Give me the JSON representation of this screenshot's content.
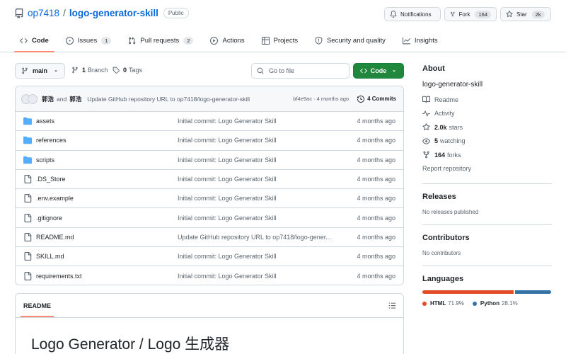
{
  "repo": {
    "owner": "op7418",
    "separator": "/",
    "name": "logo-generator-skill",
    "visibility": "Public"
  },
  "header_buttons": {
    "notifications": "Notifications",
    "fork": "Fork",
    "fork_count": "164",
    "star": "Star",
    "star_count": "2k"
  },
  "tabs": [
    {
      "label": "Code",
      "icon": "code-icon",
      "active": true
    },
    {
      "label": "Issues",
      "icon": "issue-icon",
      "count": "1"
    },
    {
      "label": "Pull requests",
      "icon": "pull-request-icon",
      "count": "2"
    },
    {
      "label": "Actions",
      "icon": "play-icon"
    },
    {
      "label": "Projects",
      "icon": "table-icon"
    },
    {
      "label": "Security and quality",
      "icon": "shield-icon"
    },
    {
      "label": "Insights",
      "icon": "graph-icon"
    }
  ],
  "toolbar": {
    "branch": "main",
    "branch_count": "1",
    "branch_label": "Branch",
    "tag_count": "0",
    "tag_label": "Tags",
    "goto_placeholder": "Go to file",
    "code_label": "Code"
  },
  "latest_commit": {
    "author1": "郭浩",
    "and": "and",
    "author2": "郭浩",
    "message": "Update GitHub repository URL to op7418/logo-generator-skill",
    "sha_time": "bf4e9ac · 4 months ago",
    "commits_label": "4 Commits"
  },
  "files": [
    {
      "type": "folder",
      "name": "assets",
      "message": "Initial commit: Logo Generator Skill",
      "age": "4 months ago"
    },
    {
      "type": "folder",
      "name": "references",
      "message": "Initial commit: Logo Generator Skill",
      "age": "4 months ago"
    },
    {
      "type": "folder",
      "name": "scripts",
      "message": "Initial commit: Logo Generator Skill",
      "age": "4 months ago"
    },
    {
      "type": "file",
      "name": ".DS_Store",
      "message": "Initial commit: Logo Generator Skill",
      "age": "4 months ago"
    },
    {
      "type": "file",
      "name": ".env.example",
      "message": "Initial commit: Logo Generator Skill",
      "age": "4 months ago"
    },
    {
      "type": "file",
      "name": ".gitignore",
      "message": "Initial commit: Logo Generator Skill",
      "age": "4 months ago"
    },
    {
      "type": "file",
      "name": "README.md",
      "message": "Update GitHub repository URL to op7418/logo-gener...",
      "age": "4 months ago"
    },
    {
      "type": "file",
      "name": "SKILL.md",
      "message": "Initial commit: Logo Generator Skill",
      "age": "4 months ago"
    },
    {
      "type": "file",
      "name": "requirements.txt",
      "message": "Initial commit: Logo Generator Skill",
      "age": "4 months ago"
    }
  ],
  "readme": {
    "tab": "README",
    "heading": "Logo Generator / Logo 生成器"
  },
  "about": {
    "title": "About",
    "description": "logo-generator-skill",
    "readme": "Readme",
    "activity": "Activity",
    "stars_count": "2.0k",
    "stars_label": "stars",
    "watching_count": "5",
    "watching_label": "watching",
    "forks_count": "164",
    "forks_label": "forks",
    "report": "Report repository"
  },
  "releases": {
    "title": "Releases",
    "note": "No releases published"
  },
  "contributors": {
    "title": "Contributors",
    "note": "No contributors"
  },
  "languages": {
    "title": "Languages",
    "items": [
      {
        "name": "HTML",
        "percent": "71.9%",
        "share": 71.9,
        "color": "#e34c26"
      },
      {
        "name": "Python",
        "percent": "28.1%",
        "share": 28.1,
        "color": "#3572A5"
      }
    ]
  },
  "colors": {
    "accent_green": "#1f883d",
    "link_blue": "#0969da",
    "tab_underline": "#fd8c73"
  }
}
